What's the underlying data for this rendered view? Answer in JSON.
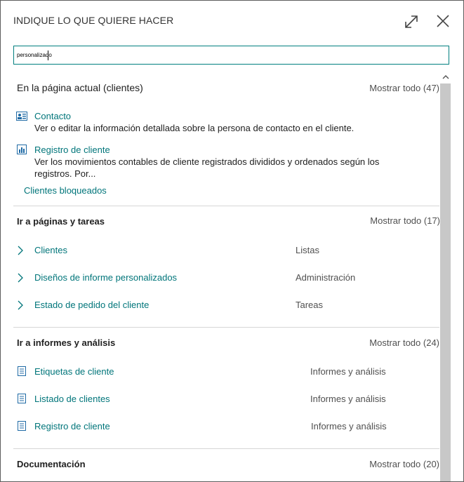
{
  "header": {
    "title": "INDIQUE LO QUE QUIERE HACER"
  },
  "search": {
    "value": "personalizado"
  },
  "sections": {
    "current_page": {
      "title": "En la página actual (clientes)",
      "show_all": "Mostrar todo (47)",
      "items": [
        {
          "title": "Contacto",
          "desc": "Ver o editar la información detallada sobre la persona de contacto en el cliente."
        },
        {
          "title": "Registro de cliente",
          "desc1": "Ver los movimientos contables de cliente registrados divididos y ordenados según los",
          "desc2": "registros. Por..."
        }
      ],
      "extra_link": "Clientes bloqueados"
    },
    "pages_tasks": {
      "title": "Ir a páginas y tareas",
      "show_all": "Mostrar todo (17)",
      "items": [
        {
          "title": "Clientes",
          "category": "Listas"
        },
        {
          "title": "Diseños de informe personalizados",
          "category": "Administración"
        },
        {
          "title": "Estado de pedido del cliente",
          "category": "Tareas"
        }
      ]
    },
    "reports": {
      "title": "Ir a informes y análisis",
      "show_all": "Mostrar todo (24)",
      "items": [
        {
          "title": "Etiquetas de cliente",
          "category": "Informes y análisis"
        },
        {
          "title": "Listado de clientes",
          "category": "Informes y análisis"
        },
        {
          "title": "Registro de cliente",
          "category": "Informes y análisis"
        }
      ]
    },
    "documentation": {
      "title": "Documentación",
      "show_all": "Mostrar todo (20)"
    }
  },
  "icons": {
    "expand": "expand-icon",
    "close": "close-icon",
    "contact": "contact-card-icon",
    "ledger": "ledger-icon",
    "chevron": "chevron-right-icon",
    "report": "report-icon"
  },
  "colors": {
    "accent": "#00757a",
    "border": "#007f7f",
    "scrollbar": "#c8c8c8"
  }
}
